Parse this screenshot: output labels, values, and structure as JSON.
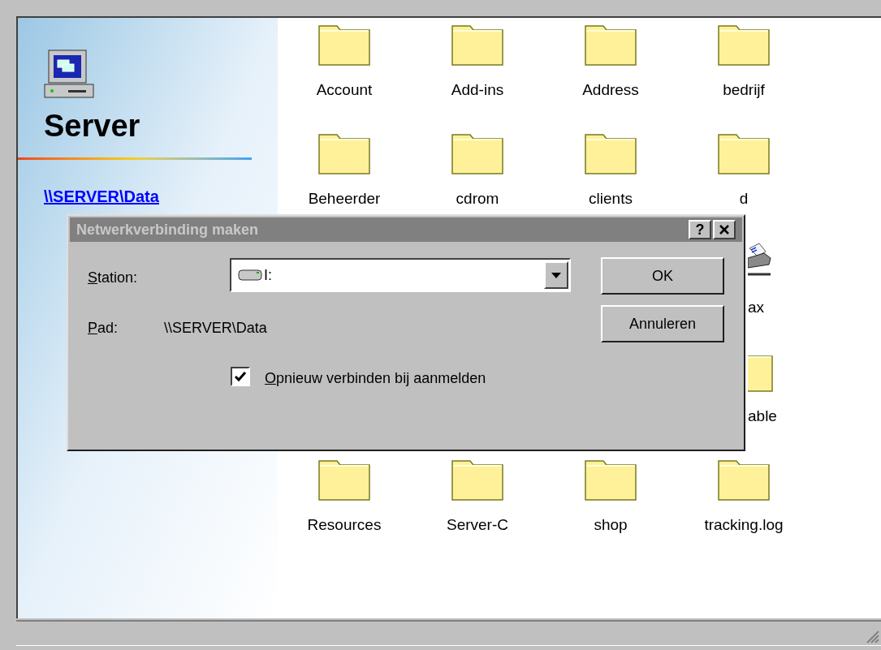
{
  "left_pane": {
    "heading": "Server",
    "link": "\\\\SERVER\\Data"
  },
  "grid": [
    {
      "items": [
        {
          "label": "Account",
          "kind": "folder"
        },
        {
          "label": "Add-ins",
          "kind": "folder"
        },
        {
          "label": "Address",
          "kind": "folder"
        },
        {
          "label": "bedrijf",
          "kind": "folder"
        }
      ]
    },
    {
      "items": [
        {
          "label": "Beheerder",
          "kind": "folder"
        },
        {
          "label": "cdrom",
          "kind": "folder"
        },
        {
          "label": "clients",
          "kind": "folder"
        },
        {
          "label": "d",
          "kind": "folder"
        }
      ]
    },
    {
      "items": [
        {
          "label": "ax",
          "kind": "fax"
        }
      ]
    },
    {
      "items": [
        {
          "label": "able",
          "kind": "folder"
        }
      ]
    },
    {
      "items": [
        {
          "label": "Resources",
          "kind": "folder"
        },
        {
          "label": "Server-C",
          "kind": "folder"
        },
        {
          "label": "shop",
          "kind": "folder"
        },
        {
          "label": "tracking.log",
          "kind": "folder"
        }
      ]
    }
  ],
  "dialog": {
    "title": "Netwerkverbinding maken",
    "help": "?",
    "station": {
      "label": "Station:",
      "value": "I:"
    },
    "path": {
      "label": "Pad:",
      "value": "\\\\SERVER\\Data"
    },
    "reconnect": {
      "label": "Opnieuw verbinden bij aanmelden",
      "checked": true
    },
    "buttons": [
      "OK",
      "Annuleren"
    ]
  }
}
